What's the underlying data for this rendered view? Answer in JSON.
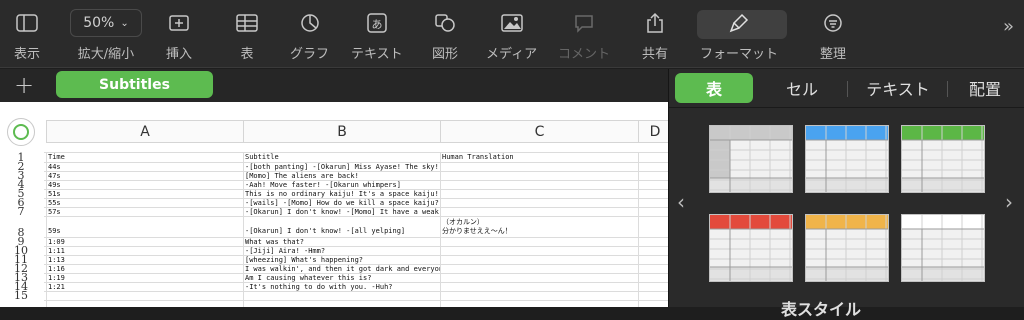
{
  "toolbar": {
    "items": [
      {
        "label": "表示",
        "icon": "sidebar-view-icon"
      },
      {
        "label": "拡大/縮小",
        "icon": "zoom-select",
        "value": "50%"
      },
      {
        "label": "挿入",
        "icon": "insert-icon"
      },
      {
        "label": "表",
        "icon": "table-icon"
      },
      {
        "label": "グラフ",
        "icon": "chart-icon"
      },
      {
        "label": "テキスト",
        "icon": "text-icon"
      },
      {
        "label": "図形",
        "icon": "shape-icon"
      },
      {
        "label": "メディア",
        "icon": "media-icon"
      },
      {
        "label": "コメント",
        "icon": "comment-icon"
      },
      {
        "label": "共有",
        "icon": "share-icon"
      },
      {
        "label": "フォーマット",
        "icon": "format-brush-icon"
      },
      {
        "label": "整理",
        "icon": "organize-icon"
      }
    ],
    "more_icon": "chevron-double-right-icon"
  },
  "sheet": {
    "tab_label": "Subtitles",
    "columns": [
      "A",
      "B",
      "C",
      "D"
    ],
    "row_numbers": [
      "1",
      "2",
      "3",
      "4",
      "5",
      "6",
      "7",
      "8",
      "9",
      "10",
      "11",
      "12",
      "13",
      "14",
      "15"
    ],
    "header_row": [
      "Time",
      "Subtitle",
      "Human Translation"
    ],
    "rows": [
      [
        "44s",
        "-[both panting] -[Okarun] Miss Ayase! The sky!",
        ""
      ],
      [
        "47s",
        "[Momo] The aliens are back!",
        ""
      ],
      [
        "49s",
        "-Aah! Move faster! -[Okarun whimpers]",
        ""
      ],
      [
        "51s",
        "This is no ordinary kaiju! It's a space kaiju!",
        ""
      ],
      [
        "55s",
        "-[wails] -[Momo] How do we kill a space kaiju?",
        ""
      ],
      [
        "57s",
        "-[Okarun] I don't know! -[Momo] It have a weak spot?",
        ""
      ],
      [
        "59s",
        "-[Okarun] I don't know! -[all yelping]",
        "（オカルン）\n分かりませええ～ん！"
      ],
      [
        "1:09",
        "What was that?",
        ""
      ],
      [
        "1:11",
        "-[Jiji] Aira! -Hmm?",
        ""
      ],
      [
        "1:13",
        "[wheezing] What's happening?",
        ""
      ],
      [
        "1:16",
        "I was walkin', and then it got dark and everyone was gone.",
        ""
      ],
      [
        "1:19",
        "Am I causing whatever this is?",
        ""
      ],
      [
        "1:21",
        "-It's nothing to do with you. -Huh?",
        ""
      ]
    ]
  },
  "panel": {
    "tabs": [
      "表",
      "セル",
      "テキスト",
      "配置"
    ],
    "active_tab": "表",
    "section_label": "表スタイル",
    "styles": [
      {
        "name": "gray",
        "color": "#c9c9c9"
      },
      {
        "name": "blue",
        "color": "#4aa3f0"
      },
      {
        "name": "green",
        "color": "#5cb746"
      },
      {
        "name": "red",
        "color": "#e34a3c"
      },
      {
        "name": "orange",
        "color": "#f0b44a"
      },
      {
        "name": "white",
        "color": "#ffffff"
      }
    ]
  },
  "colors": {
    "accent": "#5dbb50"
  }
}
